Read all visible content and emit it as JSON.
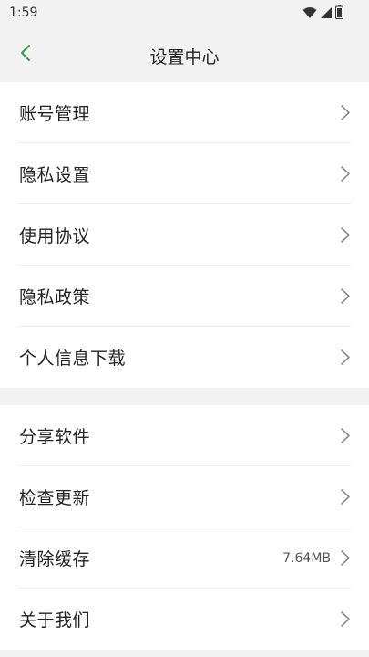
{
  "status_bar": {
    "time": "1:59",
    "icons": [
      "wifi-icon",
      "cellular-signal-icon",
      "battery-icon"
    ]
  },
  "header": {
    "title": "设置中心",
    "back_icon": "chevron-left-icon",
    "accent_color": "#2e9e46"
  },
  "groups": [
    {
      "items": [
        {
          "label": "账号管理"
        },
        {
          "label": "隐私设置"
        },
        {
          "label": "使用协议"
        },
        {
          "label": "隐私政策"
        },
        {
          "label": "个人信息下载"
        }
      ]
    },
    {
      "items": [
        {
          "label": "分享软件"
        },
        {
          "label": "检查更新"
        },
        {
          "label": "清除缓存",
          "value": "7.64MB"
        },
        {
          "label": "关于我们"
        }
      ]
    }
  ]
}
